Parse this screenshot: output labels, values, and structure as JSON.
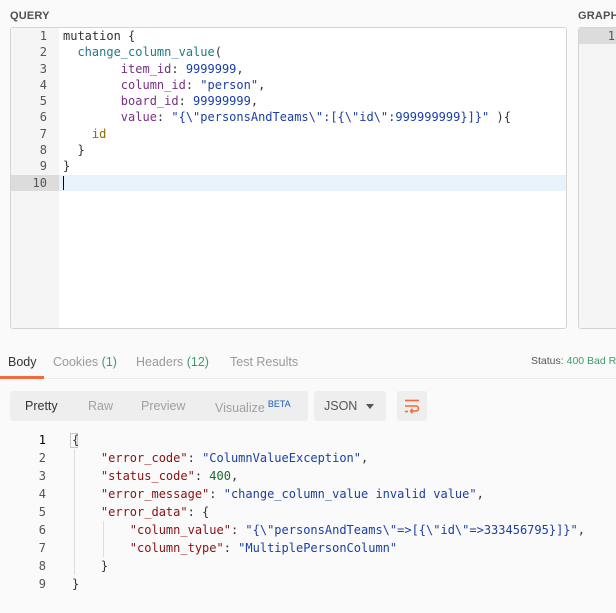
{
  "labels": {
    "query": "QUERY",
    "variables": "GRAPH"
  },
  "query_lines": [
    {
      "n": "1",
      "parts": [
        [
          "kw",
          "mutation {"
        ]
      ]
    },
    {
      "n": "2",
      "parts": [
        [
          "kw",
          "  "
        ],
        [
          "fn",
          "change_column_value"
        ],
        [
          "kw",
          "("
        ]
      ]
    },
    {
      "n": "3",
      "parts": [
        [
          "kw",
          "        "
        ],
        [
          "arg",
          "item_id"
        ],
        [
          "kw",
          ": "
        ],
        [
          "num",
          "9999999"
        ],
        [
          "kw",
          ","
        ]
      ]
    },
    {
      "n": "4",
      "parts": [
        [
          "kw",
          "        "
        ],
        [
          "arg",
          "column_id"
        ],
        [
          "kw",
          ": "
        ],
        [
          "strb",
          "\"person\""
        ],
        [
          "kw",
          ","
        ]
      ]
    },
    {
      "n": "5",
      "parts": [
        [
          "kw",
          "        "
        ],
        [
          "arg",
          "board_id"
        ],
        [
          "kw",
          ": "
        ],
        [
          "num",
          "99999999"
        ],
        [
          "kw",
          ","
        ]
      ]
    },
    {
      "n": "6",
      "parts": [
        [
          "kw",
          "        "
        ],
        [
          "arg",
          "value"
        ],
        [
          "kw",
          ": "
        ],
        [
          "strb",
          "\"{\\\"personsAndTeams\\\":[{\\\"id\\\":999999999}]}\""
        ],
        [
          "kw",
          " ){"
        ]
      ]
    },
    {
      "n": "7",
      "parts": [
        [
          "kw",
          "    "
        ],
        [
          "fld",
          "id"
        ]
      ]
    },
    {
      "n": "8",
      "parts": [
        [
          "kw",
          "  }"
        ]
      ]
    },
    {
      "n": "9",
      "parts": [
        [
          "kw",
          "}"
        ]
      ]
    },
    {
      "n": "10",
      "parts": []
    }
  ],
  "vars_lines": [
    "1"
  ],
  "tabs": [
    {
      "label": "Body",
      "count": ""
    },
    {
      "label": "Cookies",
      "count": "(1)"
    },
    {
      "label": "Headers",
      "count": "(12)"
    },
    {
      "label": "Test Results",
      "count": ""
    }
  ],
  "status": {
    "label": "Status:",
    "value": "400 Bad R"
  },
  "views": [
    "Pretty",
    "Raw",
    "Preview",
    "Visualize"
  ],
  "visualize_badge": "BETA",
  "format": "JSON",
  "response_lines": [
    {
      "n": "1",
      "parts": [
        [
          "pn",
          "{"
        ]
      ]
    },
    {
      "n": "2",
      "parts": [
        [
          "pn",
          "    "
        ],
        [
          "key",
          "\"error_code\""
        ],
        [
          "pn",
          ": "
        ],
        [
          "sval",
          "\"ColumnValueException\""
        ],
        [
          "pn",
          ","
        ]
      ]
    },
    {
      "n": "3",
      "parts": [
        [
          "pn",
          "    "
        ],
        [
          "key",
          "\"status_code\""
        ],
        [
          "pn",
          ": "
        ],
        [
          "nval",
          "400"
        ],
        [
          "pn",
          ","
        ]
      ]
    },
    {
      "n": "4",
      "parts": [
        [
          "pn",
          "    "
        ],
        [
          "key",
          "\"error_message\""
        ],
        [
          "pn",
          ": "
        ],
        [
          "sval",
          "\"change_column_value invalid value\""
        ],
        [
          "pn",
          ","
        ]
      ]
    },
    {
      "n": "5",
      "parts": [
        [
          "pn",
          "    "
        ],
        [
          "key",
          "\"error_data\""
        ],
        [
          "pn",
          ": {"
        ]
      ]
    },
    {
      "n": "6",
      "parts": [
        [
          "pn",
          "        "
        ],
        [
          "key",
          "\"column_value\""
        ],
        [
          "pn",
          ": "
        ],
        [
          "sval",
          "\"{\\\"personsAndTeams\\\"=>[{\\\"id\\\"=>333456795}]}\""
        ],
        [
          "pn",
          ","
        ]
      ]
    },
    {
      "n": "7",
      "parts": [
        [
          "pn",
          "        "
        ],
        [
          "key",
          "\"column_type\""
        ],
        [
          "pn",
          ": "
        ],
        [
          "sval",
          "\"MultiplePersonColumn\""
        ]
      ]
    },
    {
      "n": "8",
      "parts": [
        [
          "pn",
          "    }"
        ]
      ]
    },
    {
      "n": "9",
      "parts": [
        [
          "pn",
          "}"
        ]
      ]
    }
  ]
}
